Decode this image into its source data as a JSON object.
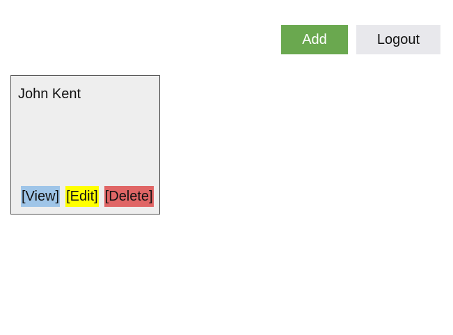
{
  "toolbar": {
    "add_label": "Add",
    "logout_label": "Logout"
  },
  "cards": [
    {
      "name": "John Kent",
      "actions": {
        "view": "[View]",
        "edit": "[Edit]",
        "delete": "[Delete]"
      }
    }
  ],
  "colors": {
    "add_button": "#6aa84f",
    "logout_button": "#e8e8ec",
    "card_background": "#eeeeee",
    "view_action": "#9fc5e8",
    "edit_action": "#ffff00",
    "delete_action": "#e06666"
  }
}
